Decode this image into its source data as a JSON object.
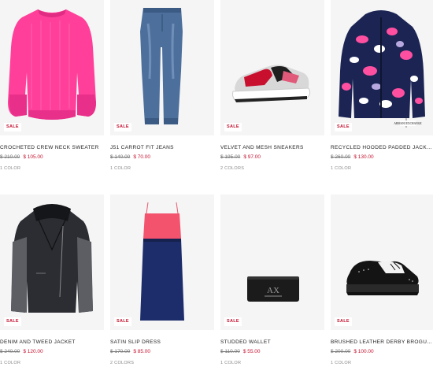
{
  "products": [
    {
      "name": "CROCHETED CREW NECK SWEATER",
      "badge": "SALE",
      "old_price": "$ 210.00",
      "new_price": "$ 105.00",
      "colors": "1 COLOR",
      "icon": "pink-sweater-image"
    },
    {
      "name": "J51 CARROT FIT JEANS",
      "badge": "SALE",
      "old_price": "$ 140.00",
      "new_price": "$ 70.00",
      "colors": "1 COLOR",
      "icon": "blue-jeans-image"
    },
    {
      "name": "VELVET AND MESH SNEAKERS",
      "badge": "SALE",
      "old_price": "$ 195.00",
      "new_price": "$ 97.00",
      "colors": "2 COLORS",
      "icon": "sneaker-image"
    },
    {
      "name": "RECYCLED HOODED PADDED JACKET",
      "badge": "SALE",
      "old_price": "$ 260.00",
      "new_price": "$ 130.00",
      "colors": "1 COLOR",
      "icon": "padded-jacket-image"
    },
    {
      "name": "DENIM AND TWEED JACKET",
      "badge": "SALE",
      "old_price": "$ 240.00",
      "new_price": "$ 120.00",
      "colors": "1 COLOR",
      "icon": "tweed-jacket-image"
    },
    {
      "name": "SATIN SLIP DRESS",
      "badge": "SALE",
      "old_price": "$ 170.00",
      "new_price": "$ 85.00",
      "colors": "2 COLORS",
      "icon": "slip-dress-image"
    },
    {
      "name": "STUDDED WALLET",
      "badge": "SALE",
      "old_price": "$ 110.00",
      "new_price": "$ 55.00",
      "colors": "1 COLOR",
      "icon": "wallet-image"
    },
    {
      "name": "BRUSHED LEATHER DERBY BROGUES SH...",
      "badge": "SALE",
      "old_price": "$ 200.00",
      "new_price": "$ 100.00",
      "colors": "1 COLOR",
      "icon": "brogue-shoe-image"
    }
  ],
  "wallet_logo": "AX",
  "jacket_tag": "ARMANI EXCHANGE",
  "colors": {
    "sale_red": "#c4122f",
    "tile_bg": "#f5f5f5"
  }
}
